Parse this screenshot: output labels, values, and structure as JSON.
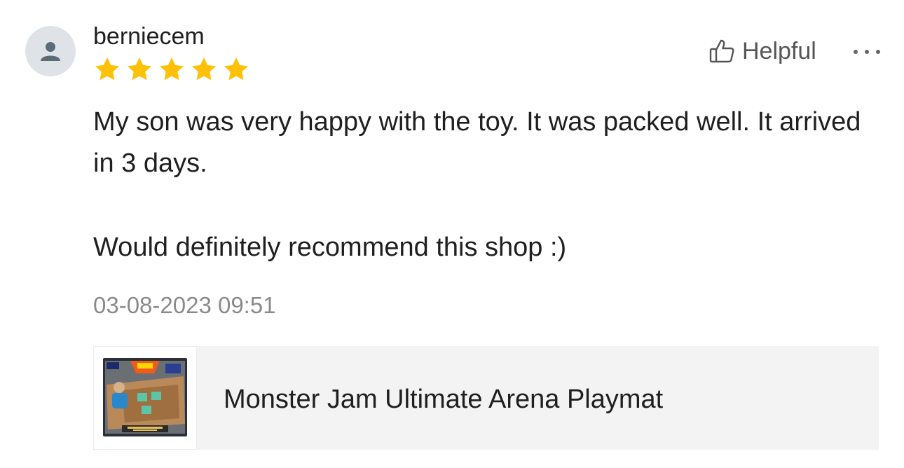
{
  "review": {
    "user": {
      "name": "berniecem",
      "avatar_icon": "person-icon"
    },
    "rating": {
      "value": 5,
      "max": 5,
      "star_color": "#FFC107"
    },
    "actions": {
      "helpful_label": "Helpful",
      "helpful_icon": "thumbs-up-icon",
      "more_icon": "more-horizontal-icon"
    },
    "body": {
      "paragraphs": [
        "My son was very happy with the toy. It was packed well. It arrived in 3 days.",
        "Would definitely recommend this shop :)"
      ]
    },
    "timestamp": "03-08-2023 09:51",
    "product": {
      "name": "Monster Jam Ultimate Arena Playmat",
      "thumbnail_icon": "product-image"
    }
  }
}
